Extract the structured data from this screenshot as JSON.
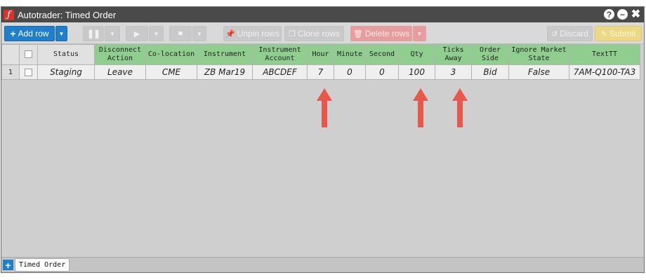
{
  "window": {
    "title": "Autotrader: Timed Order",
    "controls": {
      "help": "?",
      "minimize": "−",
      "close": "✖"
    }
  },
  "toolbar": {
    "add_row": "Add row",
    "unpin_rows": "Unpin rows",
    "clone_rows": "Clone rows",
    "delete_rows": "Delete rows",
    "discard": "Discard",
    "submit": "Submit"
  },
  "grid": {
    "columns": [
      {
        "label": "Status",
        "highlight": false
      },
      {
        "label": "Disconnect Action",
        "highlight": true
      },
      {
        "label": "Co-location",
        "highlight": true
      },
      {
        "label": "Instrument",
        "highlight": true
      },
      {
        "label": "Instrument Account",
        "highlight": true
      },
      {
        "label": "Hour",
        "highlight": true
      },
      {
        "label": "Minute",
        "highlight": true
      },
      {
        "label": "Second",
        "highlight": true
      },
      {
        "label": "Qty",
        "highlight": true
      },
      {
        "label": "Ticks Away",
        "highlight": true
      },
      {
        "label": "Order Side",
        "highlight": true
      },
      {
        "label": "Ignore Market State",
        "highlight": true
      },
      {
        "label": "TextTT",
        "highlight": true
      }
    ],
    "rows": [
      {
        "number": "1",
        "cells": [
          "Staging",
          "Leave",
          "CME",
          "ZB Mar19",
          "ABCDEF",
          "7",
          "0",
          "0",
          "100",
          "3",
          "Bid",
          "False",
          "7AM-Q100-TA3"
        ]
      }
    ]
  },
  "annotations": {
    "arrow_color": "#e8584a",
    "arrow_targets": [
      "Hour",
      "Qty",
      "Ticks Away"
    ]
  },
  "bottom": {
    "add_tab": "+",
    "tabs": [
      "Timed Order"
    ]
  },
  "colors": {
    "title_bar": "#4a4a4a",
    "accent_blue": "#1f7fcb",
    "header_green": "#8fce8f",
    "delete_red": "#e79d9d",
    "submit_yellow": "#ecd985"
  }
}
